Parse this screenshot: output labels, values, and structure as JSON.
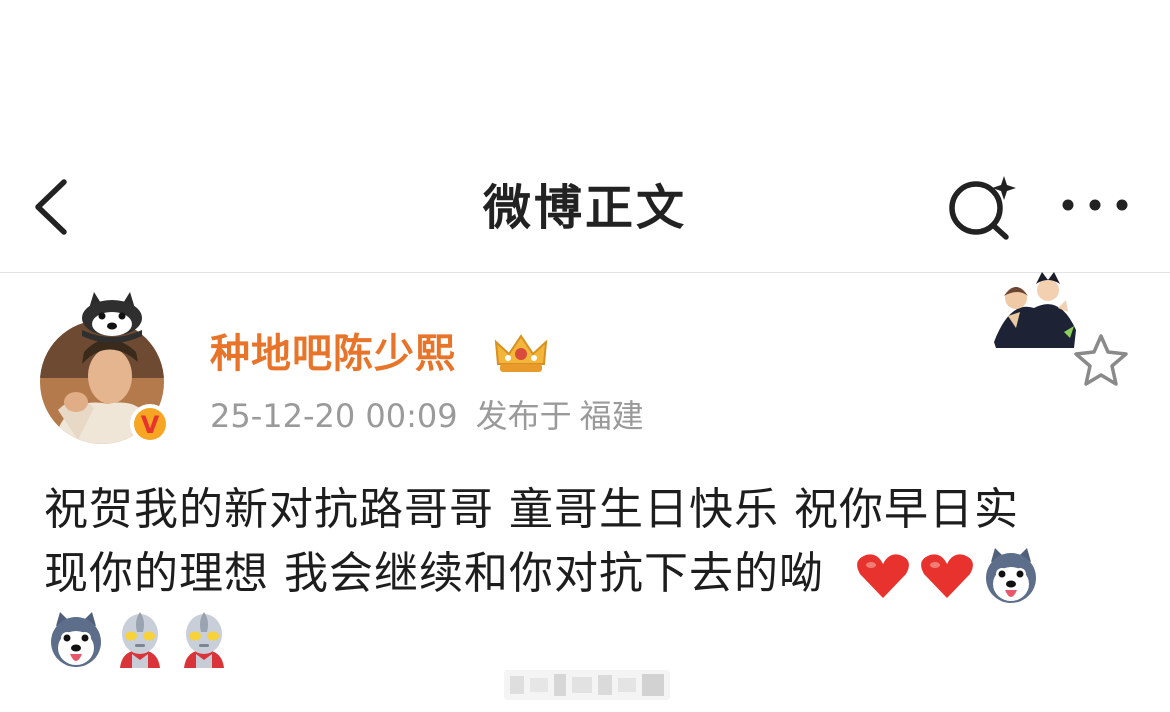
{
  "navbar": {
    "title": "微博正文",
    "back_icon": "chevron-left-icon",
    "search_icon": "search-sparkle-icon",
    "more_icon": "more-dots-icon"
  },
  "author": {
    "name": "种地吧陈少熙",
    "badge_icon": "crown-badge-icon",
    "verified_icon": "verified-v-icon",
    "timestamp": "25-12-20 00:09",
    "published_label": "发布于",
    "location": "福建"
  },
  "post": {
    "text_line1": "祝贺我的新对抗路哥哥 童哥生日快乐 祝你早日实",
    "text_line2": "现你的理想 我会继续和你对抗下去的呦",
    "emojis": [
      "heart-emoji",
      "heart-emoji",
      "husky-emoji",
      "husky-emoji",
      "ultraman-emoji",
      "ultraman-emoji"
    ]
  },
  "colors": {
    "author_name": "#e8742a",
    "meta_text": "#9a9a9a",
    "title_text": "#222222",
    "heart": "#e8322e",
    "verified": "#f6a623"
  }
}
